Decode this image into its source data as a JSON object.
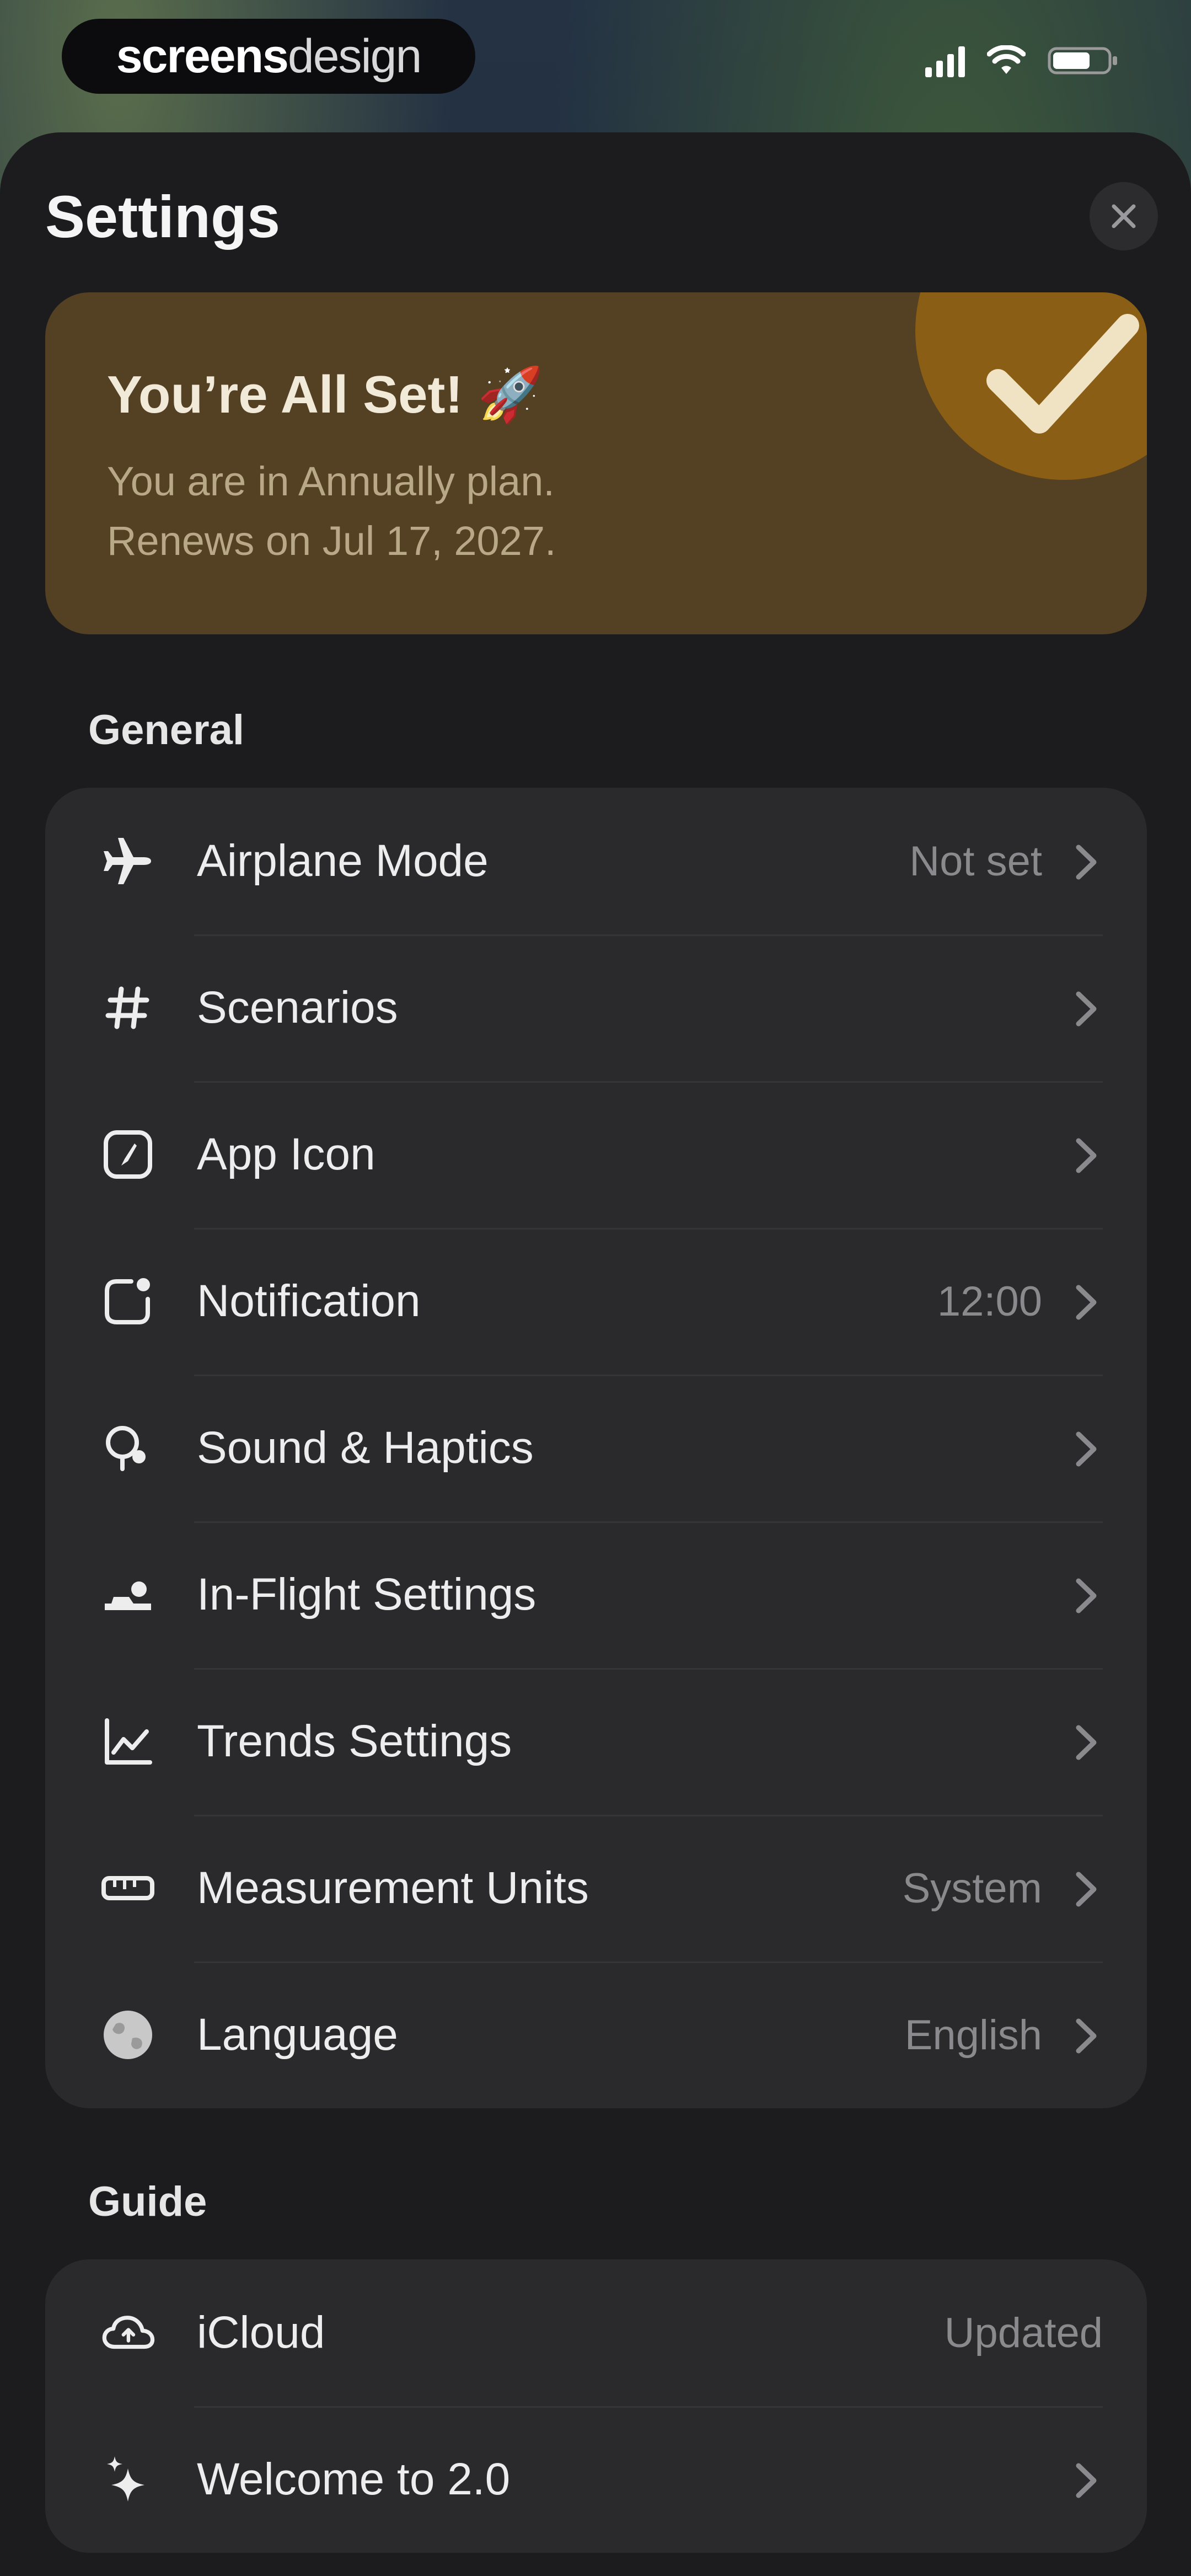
{
  "brand": {
    "part1": "screens",
    "part2": "design"
  },
  "sheet": {
    "title": "Settings"
  },
  "banner": {
    "title": "You’re All Set! 🚀",
    "line1": "You are in Annually plan.",
    "line2": "Renews on Jul 17, 2027."
  },
  "sections": {
    "general": {
      "label": "General",
      "items": [
        {
          "label": "Airplane Mode",
          "value": "Not set",
          "icon": "airplane-icon"
        },
        {
          "label": "Scenarios",
          "value": "",
          "icon": "hash-icon"
        },
        {
          "label": "App Icon",
          "value": "",
          "icon": "app-icon-icon"
        },
        {
          "label": "Notification",
          "value": "12:00",
          "icon": "notification-icon"
        },
        {
          "label": "Sound & Haptics",
          "value": "",
          "icon": "sound-icon"
        },
        {
          "label": "In-Flight Settings",
          "value": "",
          "icon": "in-flight-icon"
        },
        {
          "label": "Trends Settings",
          "value": "",
          "icon": "trends-icon"
        },
        {
          "label": "Measurement Units",
          "value": "System",
          "icon": "ruler-icon"
        },
        {
          "label": "Language",
          "value": "English",
          "icon": "globe-icon"
        }
      ]
    },
    "guide": {
      "label": "Guide",
      "items": [
        {
          "label": "iCloud",
          "value": "Updated",
          "icon": "cloud-icon"
        },
        {
          "label": "Welcome to 2.0",
          "value": "",
          "icon": "sparkle-icon"
        }
      ]
    }
  },
  "colors": {
    "sheet_bg": "#1c1c1e",
    "group_bg": "#2a2a2c",
    "banner_bg": "#544022",
    "banner_accent": "#8a5e14",
    "secondary_text": "#8a8a8e"
  }
}
